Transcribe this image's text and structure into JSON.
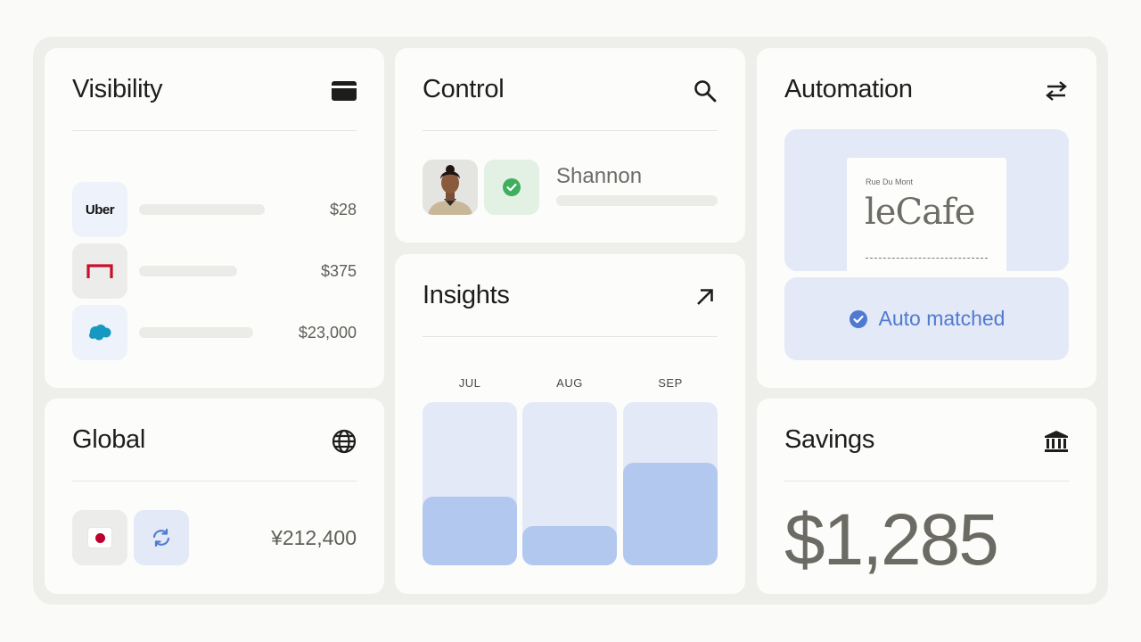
{
  "visibility": {
    "title": "Visibility",
    "transactions": [
      {
        "merchant": "Uber",
        "amount": "$28"
      },
      {
        "merchant": "",
        "amount": "$375"
      },
      {
        "merchant": "",
        "amount": "$23,000"
      }
    ]
  },
  "control": {
    "title": "Control",
    "name": "Shannon"
  },
  "automation": {
    "title": "Automation",
    "receipt_subtitle": "Rue Du Mont",
    "receipt_brand": "leCafe",
    "status": "Auto matched"
  },
  "global": {
    "title": "Global",
    "amount": "¥212,400"
  },
  "insights": {
    "title": "Insights",
    "months": [
      {
        "label": "JUL",
        "level": 0.42
      },
      {
        "label": "AUG",
        "level": 0.24
      },
      {
        "label": "SEP",
        "level": 0.63
      }
    ]
  },
  "savings": {
    "title": "Savings",
    "value": "$1,285"
  },
  "colors": {
    "accent_blue": "#4f7ad1",
    "tile_blue": "#e3e9f7",
    "bar_fill": "#b3c8ee",
    "success_green": "#3fae5d",
    "brand_red": "#c8102e",
    "salesforce_blue": "#1798c1"
  },
  "icons": {
    "visibility": "card-icon",
    "control": "search-icon",
    "automation": "swap-arrows-icon",
    "global": "globe-icon",
    "insights": "arrow-up-right-icon",
    "savings": "bank-icon"
  }
}
